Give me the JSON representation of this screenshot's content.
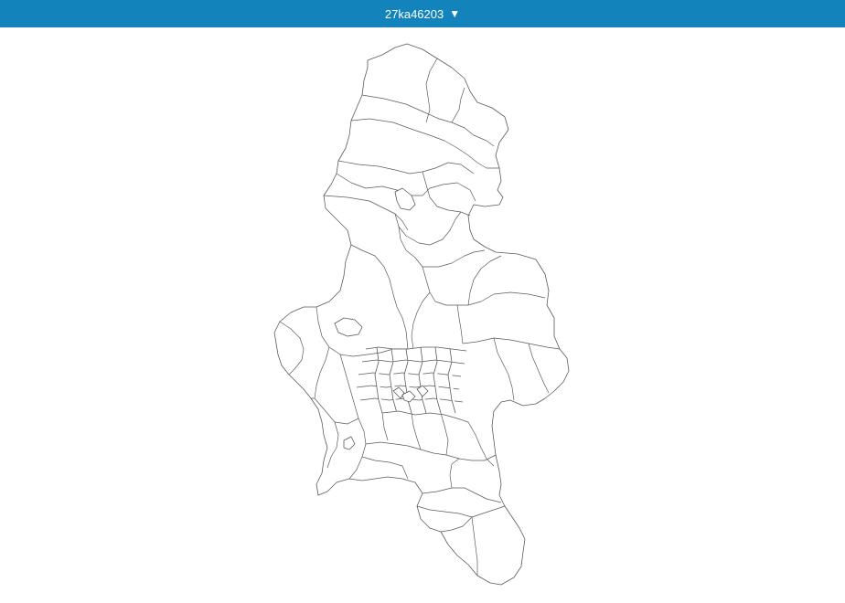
{
  "header": {
    "selector_label": "27ka46203",
    "caret_icon": "triangle-down-icon"
  },
  "colors": {
    "header_bg": "#1284bb",
    "header_text": "#ffffff",
    "boundary_stroke": "#5a5a5a",
    "region_fill": "#ffffff"
  }
}
